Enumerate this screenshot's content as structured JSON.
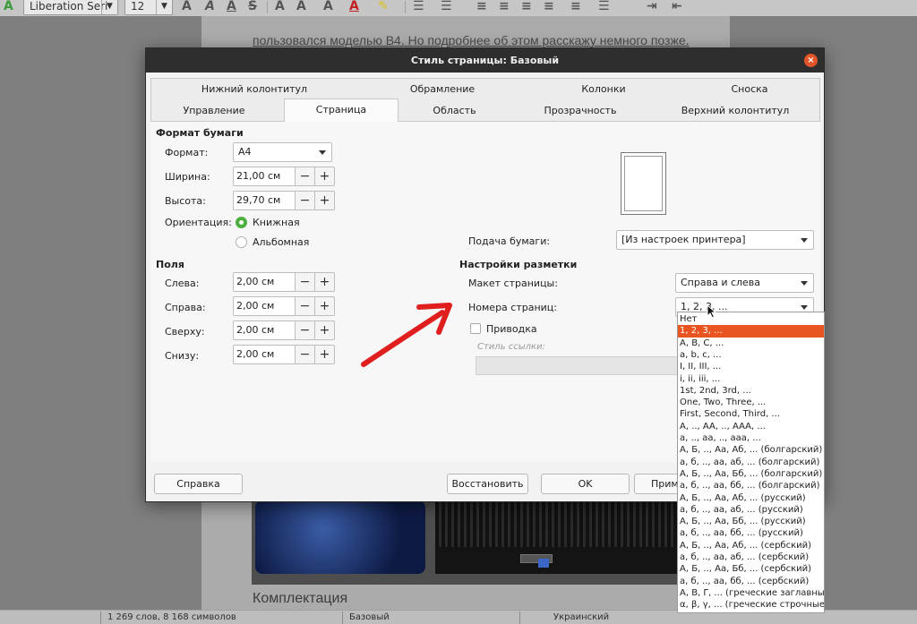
{
  "toolbar": {
    "font_name": "Liberation Seri",
    "font_size": "12"
  },
  "document": {
    "heading_line": "пользовался моделью B4. Но подробнее об этом расскажу немного позже.",
    "section_title": "Комплектация"
  },
  "statusbar": {
    "words": "1 269 слов, 8 168 символов",
    "style": "Базовый",
    "language": "Украинский"
  },
  "dialog": {
    "title": "Стиль страницы: Базовый",
    "close_symbol": "×",
    "tabs_row1": [
      "Нижний колонтитул",
      "Обрамление",
      "Колонки",
      "Сноска"
    ],
    "tabs_row2": [
      "Управление",
      "Страница",
      "Область",
      "Прозрачность",
      "Верхний колонтитул"
    ],
    "active_tab": "Страница",
    "paper": {
      "title": "Формат бумаги",
      "format_label": "Формат:",
      "format_value": "A4",
      "width_label": "Ширина:",
      "width_value": "21,00 см",
      "height_label": "Высота:",
      "height_value": "29,70 см",
      "orientation_label": "Ориентация:",
      "portrait": "Книжная",
      "landscape": "Альбомная",
      "tray_label": "Подача бумаги:",
      "tray_value": "[Из настроек принтера]"
    },
    "margins": {
      "title": "Поля",
      "left_label": "Слева:",
      "left_value": "2,00 см",
      "right_label": "Справа:",
      "right_value": "2,00 см",
      "top_label": "Сверху:",
      "top_value": "2,00 см",
      "bottom_label": "Снизу:",
      "bottom_value": "2,00 см"
    },
    "layout": {
      "title": "Настройки разметки",
      "page_layout_label": "Макет страницы:",
      "page_layout_value": "Справа и слева",
      "page_numbers_label": "Номера страниц:",
      "page_numbers_value": "1, 2, 3, ...",
      "register_label": "Приводка",
      "ref_style_label": "Стиль ссылки:"
    },
    "buttons": {
      "help": "Справка",
      "reset": "Восстановить",
      "ok": "OK",
      "apply": "Прим"
    },
    "numbering_options": [
      "Нет",
      "1, 2, 3, ...",
      "A, B, C, ...",
      "a, b, c, ...",
      "I, II, III, ...",
      "i, ii, iii, ...",
      "1st, 2nd, 3rd, ...",
      "One, Two, Three, ...",
      "First, Second, Third, ...",
      "A, .., AA, .., AAA, ...",
      "a, .., aa, .., aaa, ...",
      "А, Б, .., Аа, Аб, ... (болгарский)",
      "а, б, .., аа, аб, ... (болгарский)",
      "А, Б, .., Аа, Бб, ... (болгарский)",
      "а, б, .., аа, бб, ... (болгарский)",
      "А, Б, .., Аа, Аб, ... (русский)",
      "а, б, .., аа, аб, ... (русский)",
      "А, Б, .., Аа, Бб, ... (русский)",
      "а, б, .., аа, бб, ... (русский)",
      "А, Б, .., Аа, Аб, ... (сербский)",
      "а, б, .., аа, аб, ... (сербский)",
      "А, Б, .., Аа, Бб, ... (сербский)",
      "а, б, .., аа, бб, ... (сербский)",
      "Α, Β, Γ, ... (греческие заглавные)",
      "α, β, γ, ... (греческие строчные)"
    ],
    "selected_option": 1
  },
  "colors": {
    "accent": "#e95420",
    "radio_on": "#4caf3f",
    "annotation_arrow": "#e01e1e",
    "titlebar": "#2e2e2e"
  }
}
